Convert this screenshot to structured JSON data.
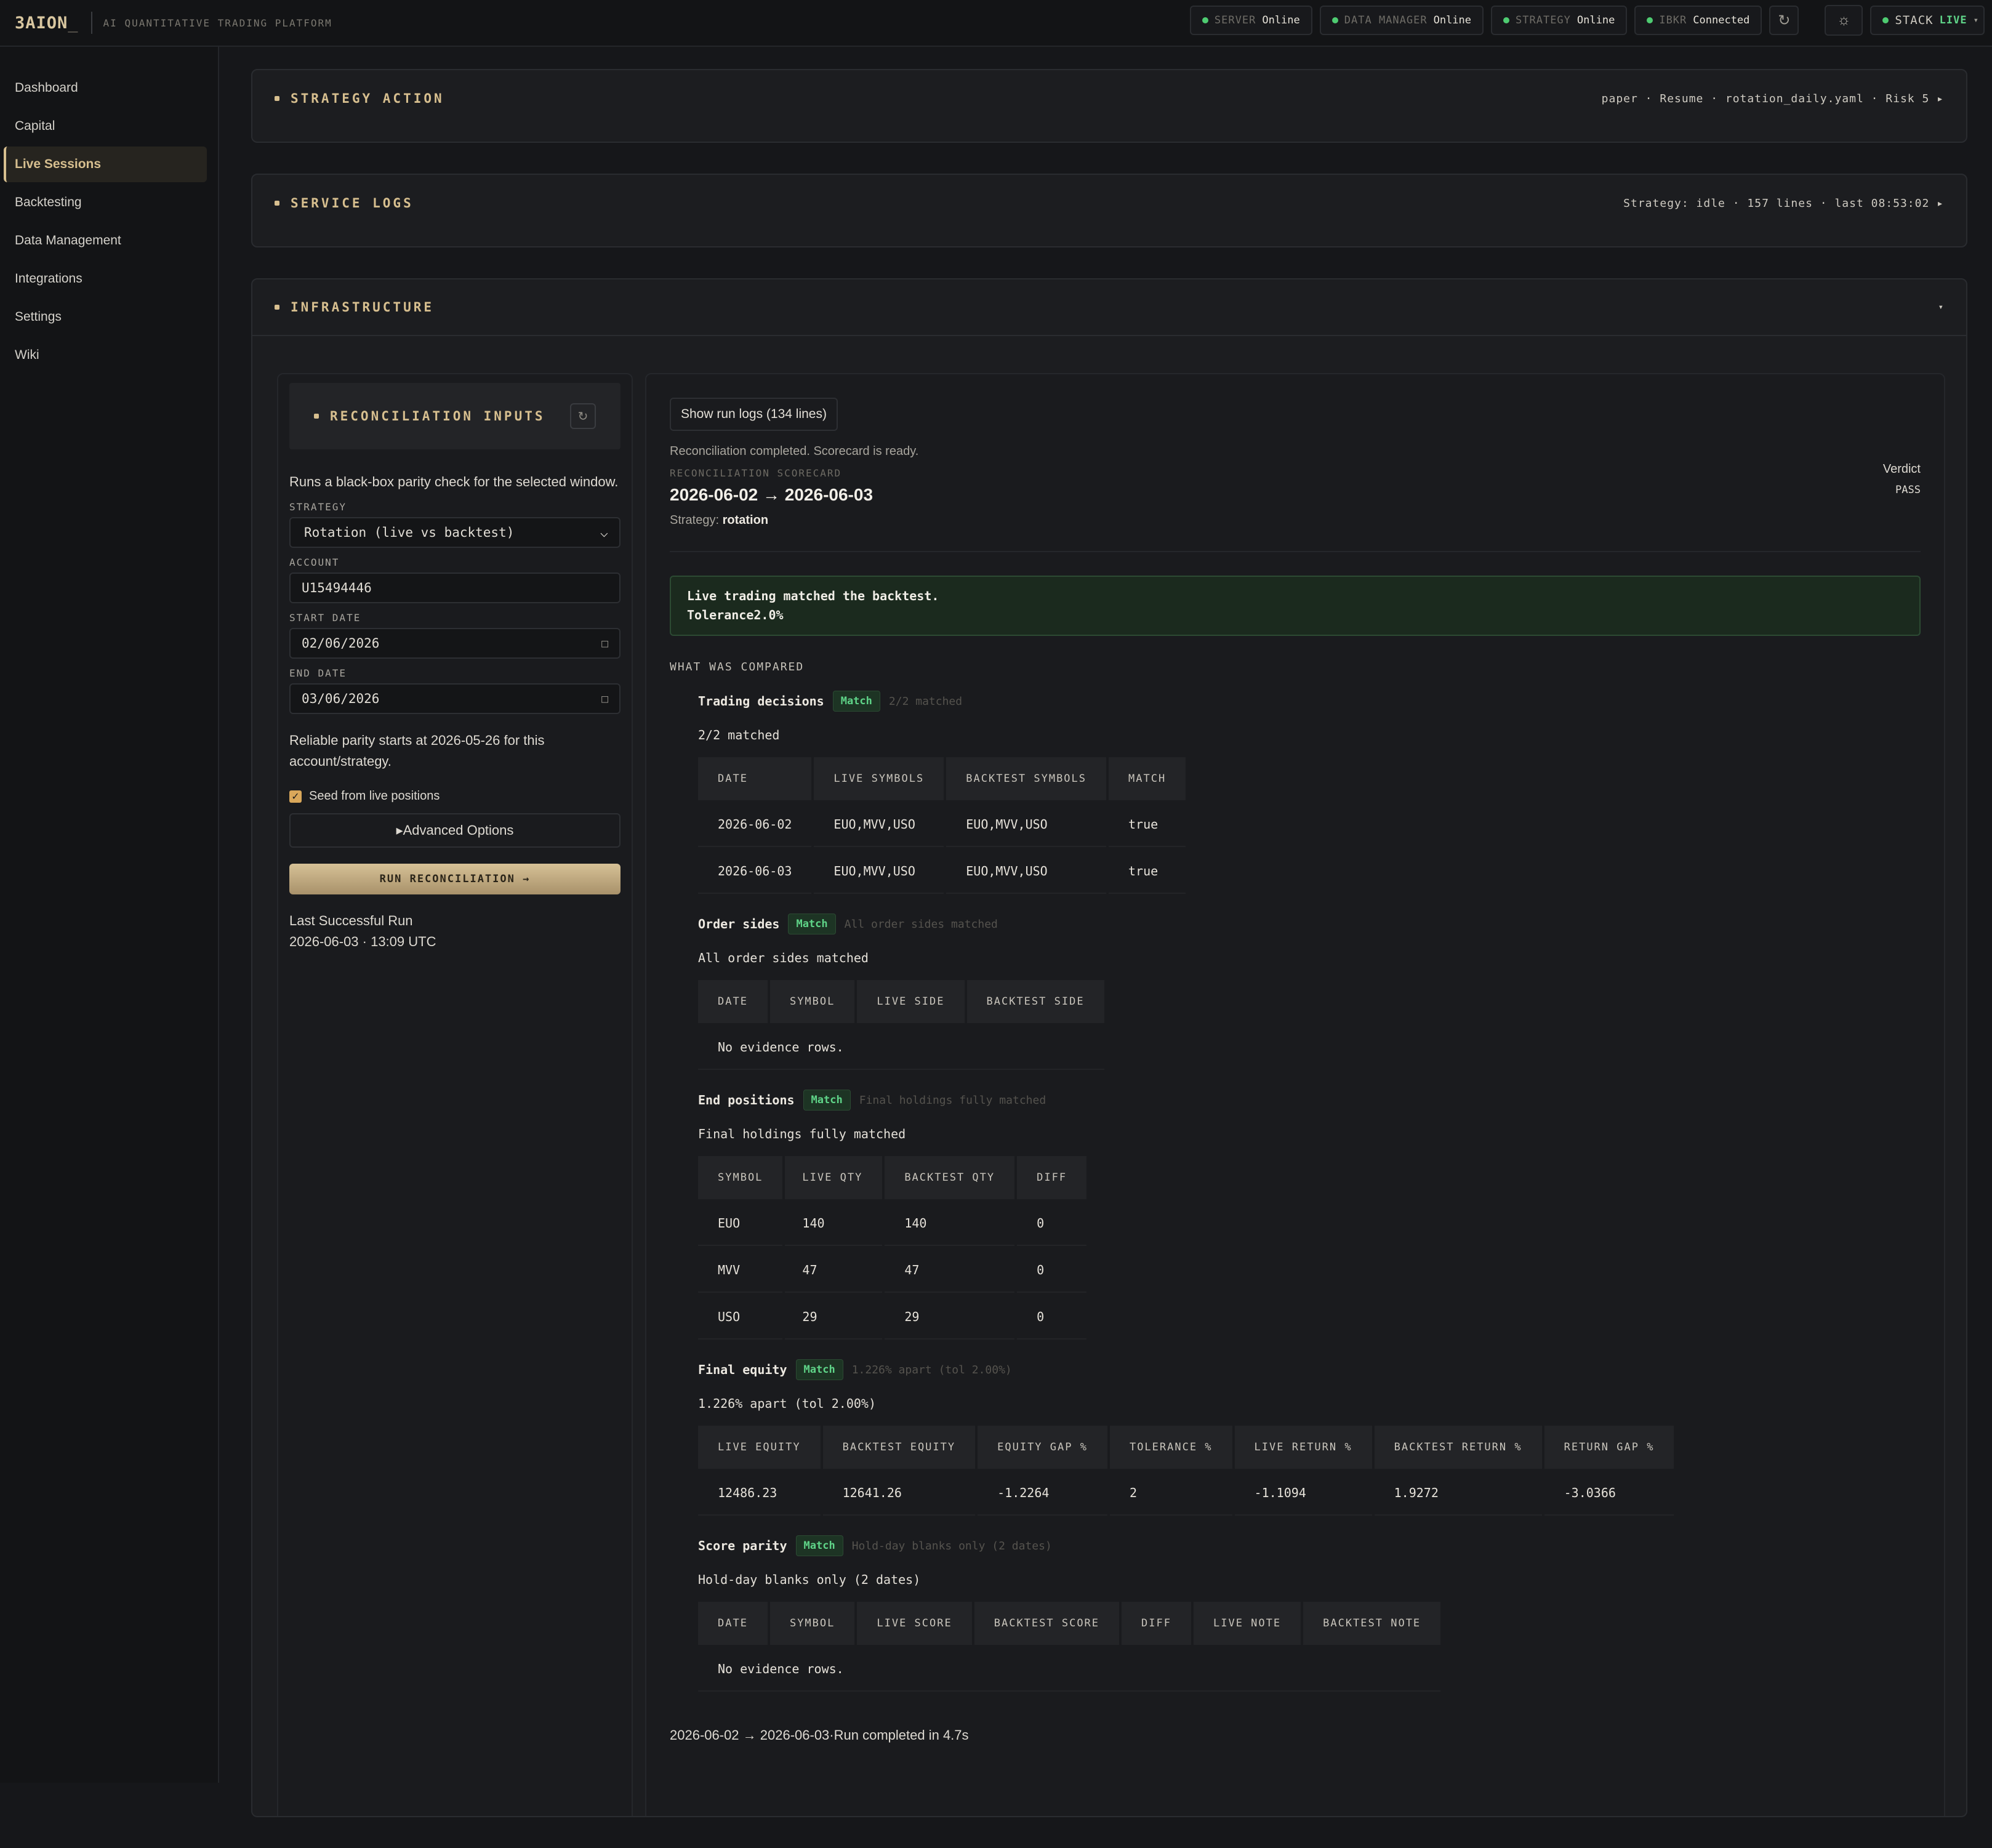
{
  "brand": {
    "name": "3AION",
    "cursor": "_",
    "subtitle": "AI QUANTITATIVE TRADING PLATFORM"
  },
  "status": {
    "server": {
      "label": "SERVER",
      "value": "Online"
    },
    "data_manager": {
      "label": "DATA MANAGER",
      "value": "Online"
    },
    "strategy": {
      "label": "STRATEGY",
      "value": "Online"
    },
    "ibkr": {
      "label": "IBKR",
      "value": "Connected"
    },
    "stack": {
      "label": "STACK",
      "value": "LIVE"
    }
  },
  "sidebar": {
    "items": [
      {
        "label": "Dashboard"
      },
      {
        "label": "Capital"
      },
      {
        "label": "Live Sessions",
        "active": true
      },
      {
        "label": "Backtesting"
      },
      {
        "label": "Data Management"
      },
      {
        "label": "Integrations"
      },
      {
        "label": "Settings"
      },
      {
        "label": "Wiki"
      }
    ]
  },
  "panels": {
    "strategy_action": {
      "title": "STRATEGY ACTION",
      "meta": "paper · Resume · rotation_daily.yaml · Risk 5 ▸"
    },
    "service_logs": {
      "title": "SERVICE LOGS",
      "meta": "Strategy: idle · 157 lines · last 08:53:02 ▸"
    },
    "infrastructure": {
      "title": "INFRASTRUCTURE",
      "meta": "▾"
    }
  },
  "recon_inputs": {
    "title": "RECONCILIATION INPUTS",
    "description": "Runs a black-box parity check for the selected window.",
    "strategy_label": "STRATEGY",
    "strategy_value": "Rotation (live vs backtest)",
    "account_label": "ACCOUNT",
    "account_value": "U15494446",
    "start_label": "START DATE",
    "start_value": "02/06/2026",
    "end_label": "END DATE",
    "end_value": "03/06/2026",
    "parity_note": "Reliable parity starts at 2026-05-26 for this account/strategy.",
    "seed_label": "Seed from live positions",
    "advanced_label": "▸Advanced Options",
    "run_label": "RUN RECONCILIATION →",
    "last_run_label": "Last Successful Run",
    "last_run_value": "2026-06-03 · 13:09 UTC"
  },
  "results": {
    "logs_button": "Show run logs (134 lines)",
    "completed": "Reconciliation completed. Scorecard is ready.",
    "scorecard_label": "RECONCILIATION SCORECARD",
    "range": "2026-06-02 → 2026-06-03",
    "strategy_prefix": "Strategy:",
    "strategy_name": "rotation",
    "verdict_label": "Verdict",
    "verdict_value": "PASS",
    "banner_line1": "Live trading matched the backtest.",
    "banner_line2": "Tolerance2.0%",
    "what_compared": "WHAT WAS COMPARED",
    "footer": "2026-06-02 → 2026-06-03·Run completed in 4.7s"
  },
  "comparisons": {
    "trading": {
      "title": "Trading decisions",
      "badge": "Match",
      "sub": "2/2 matched",
      "text": "2/2 matched",
      "headers": [
        "DATE",
        "LIVE SYMBOLS",
        "BACKTEST SYMBOLS",
        "MATCH"
      ],
      "rows": [
        [
          "2026-06-02",
          "EUO,MVV,USO",
          "EUO,MVV,USO",
          "true"
        ],
        [
          "2026-06-03",
          "EUO,MVV,USO",
          "EUO,MVV,USO",
          "true"
        ]
      ]
    },
    "orders": {
      "title": "Order sides",
      "badge": "Match",
      "sub": "All order sides matched",
      "text": "All order sides matched",
      "headers": [
        "DATE",
        "SYMBOL",
        "LIVE SIDE",
        "BACKTEST SIDE"
      ],
      "empty": "No evidence rows."
    },
    "positions": {
      "title": "End positions",
      "badge": "Match",
      "sub": "Final holdings fully matched",
      "text": "Final holdings fully matched",
      "headers": [
        "SYMBOL",
        "LIVE QTY",
        "BACKTEST QTY",
        "DIFF"
      ],
      "rows": [
        [
          "EUO",
          "140",
          "140",
          "0"
        ],
        [
          "MVV",
          "47",
          "47",
          "0"
        ],
        [
          "USO",
          "29",
          "29",
          "0"
        ]
      ]
    },
    "equity": {
      "title": "Final equity",
      "badge": "Match",
      "sub": "1.226% apart (tol 2.00%)",
      "text": "1.226% apart (tol 2.00%)",
      "headers": [
        "LIVE EQUITY",
        "BACKTEST EQUITY",
        "EQUITY GAP %",
        "TOLERANCE %",
        "LIVE RETURN %",
        "BACKTEST RETURN %",
        "RETURN GAP %"
      ],
      "rows": [
        [
          "12486.23",
          "12641.26",
          "-1.2264",
          "2",
          "-1.1094",
          "1.9272",
          "-3.0366"
        ]
      ]
    },
    "score": {
      "title": "Score parity",
      "badge": "Match",
      "sub": "Hold-day blanks only (2 dates)",
      "text": "Hold-day blanks only (2 dates)",
      "headers": [
        "DATE",
        "SYMBOL",
        "LIVE SCORE",
        "BACKTEST SCORE",
        "DIFF",
        "LIVE NOTE",
        "BACKTEST NOTE"
      ],
      "empty": "No evidence rows."
    }
  }
}
